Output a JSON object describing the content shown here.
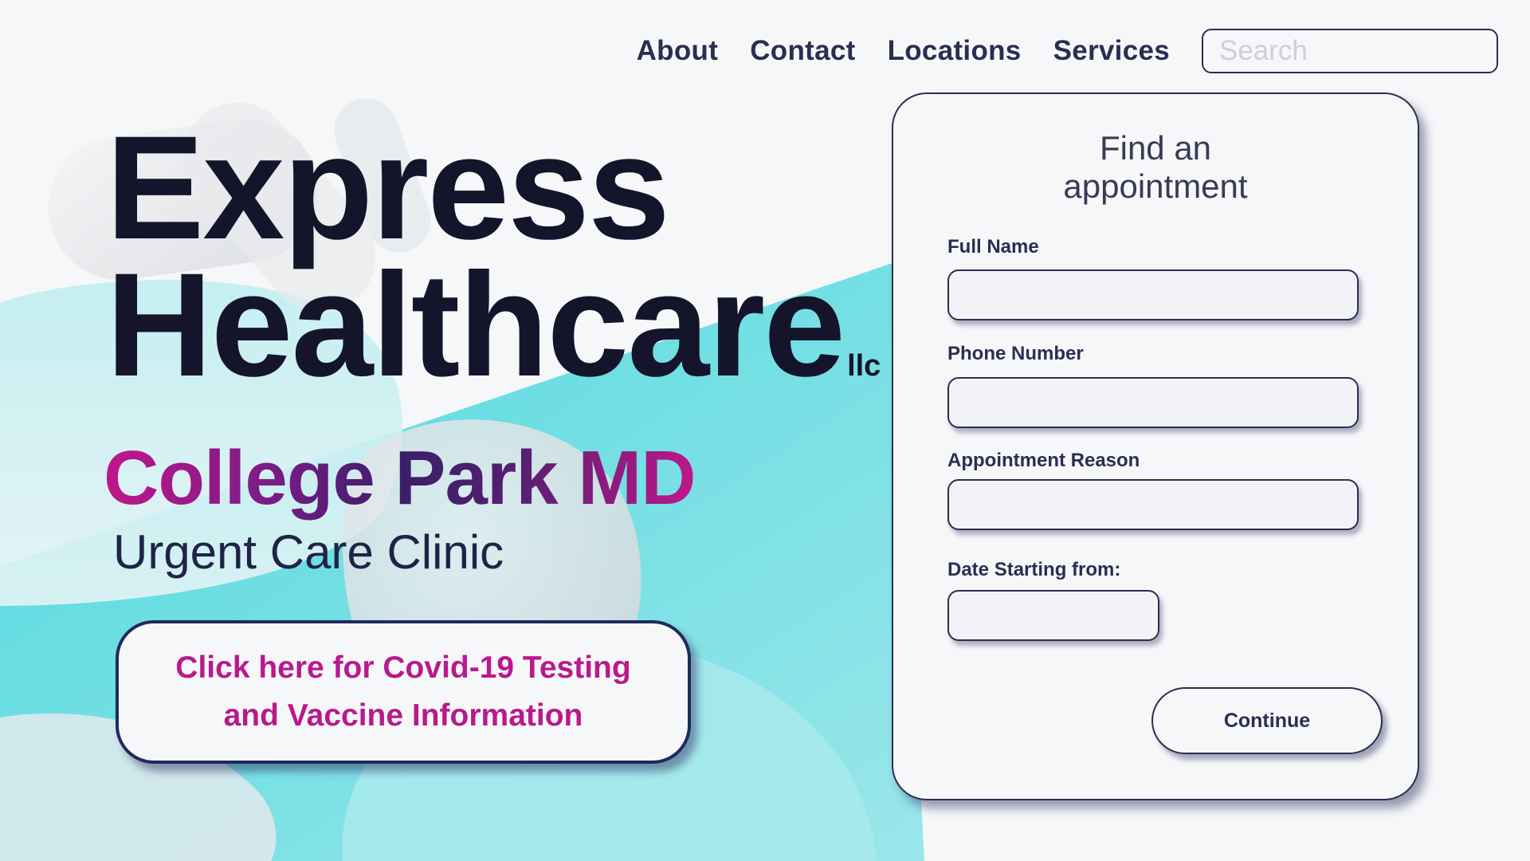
{
  "nav": {
    "links": [
      "About",
      "Contact",
      "Locations",
      "Services"
    ],
    "search_placeholder": "Search"
  },
  "hero": {
    "brand_line1": "Express",
    "brand_line2": "Healthcare",
    "brand_suffix": "llc",
    "city": "College Park MD",
    "subtitle": "Urgent Care Clinic",
    "covid_line1": "Click here for Covid-19 Testing",
    "covid_line2": "and Vaccine Information"
  },
  "form": {
    "title": "Find an appointment",
    "full_name_label": "Full Name",
    "phone_label": "Phone Number",
    "reason_label": "Appointment Reason",
    "date_label": "Date Starting from:",
    "continue_label": "Continue",
    "full_name_value": "",
    "phone_value": "",
    "reason_value": "",
    "date_value": ""
  },
  "colors": {
    "navy": "#2d2d52",
    "magenta": "#b81a8c",
    "teal": "#5edde2",
    "background": "#f6f7f9"
  }
}
